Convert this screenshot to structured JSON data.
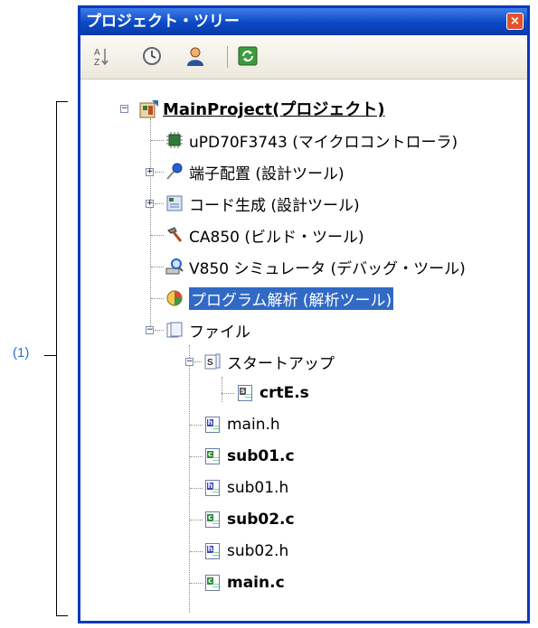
{
  "callout": {
    "label": "(1)"
  },
  "panel": {
    "title": "プロジェクト・ツリー",
    "close_glyph": "×"
  },
  "toolbar": {
    "buttons": [
      "sort-icon",
      "clock-icon",
      "user-icon",
      "refresh-icon"
    ]
  },
  "tree": {
    "project": "MainProject(プロジェクト)",
    "microcontroller": "uPD70F3743 (マイクロコントローラ)",
    "pin_config": "端子配置 (設計ツール)",
    "code_gen": "コード生成 (設計ツール)",
    "build_tool": "CA850 (ビルド・ツール)",
    "debug_tool": "V850 シミュレータ (デバッグ・ツール)",
    "analysis_tool": "プログラム解析 (解析ツール)",
    "files_folder": "ファイル",
    "startup_folder": "スタートアップ",
    "files": [
      "crtE.s",
      "main.h",
      "sub01.c",
      "sub01.h",
      "sub02.c",
      "sub02.h",
      "main.c"
    ]
  }
}
